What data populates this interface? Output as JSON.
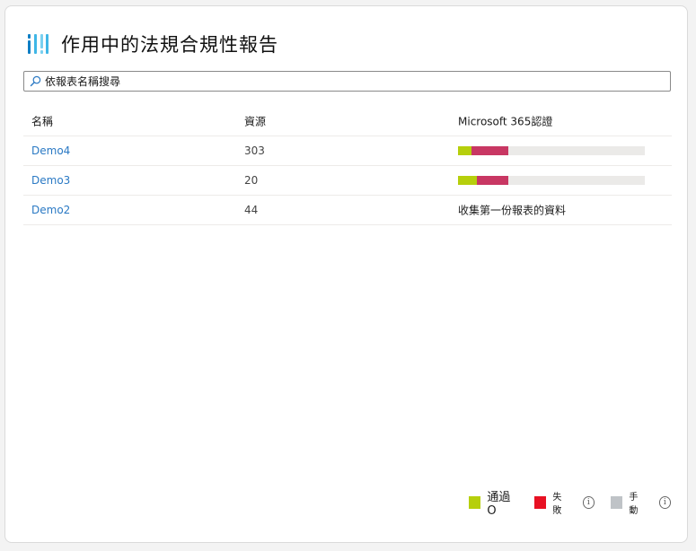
{
  "header": {
    "title": "作用中的法規合規性報告",
    "logo_icon": "compliance-logo-icon",
    "logo_colors": [
      "#0e7ec4",
      "#3fb6e6",
      "#7ad0f0"
    ]
  },
  "search": {
    "placeholder": "依報表名稱搜尋",
    "icon": "search-icon"
  },
  "table": {
    "headers": [
      "名稱",
      "資源",
      "Microsoft 365認證"
    ],
    "rows": [
      {
        "name": "Demo4",
        "resources": "303",
        "status": "",
        "pass_fraction": 0.07,
        "fail_fraction": 0.2
      },
      {
        "name": "Demo3",
        "resources": "20",
        "status": "",
        "pass_fraction": 0.1,
        "fail_fraction": 0.17
      },
      {
        "name": "Demo2",
        "resources": "44",
        "status": "收集第一份報表的資料"
      }
    ]
  },
  "legend": {
    "pass_label": "通過 O",
    "fail_label": "失敗",
    "manual_label": "手動",
    "info_glyph": "i",
    "pass_color": "#b6cf0c",
    "fail_color": "#e81123",
    "manual_color": "#bfc3c7"
  }
}
